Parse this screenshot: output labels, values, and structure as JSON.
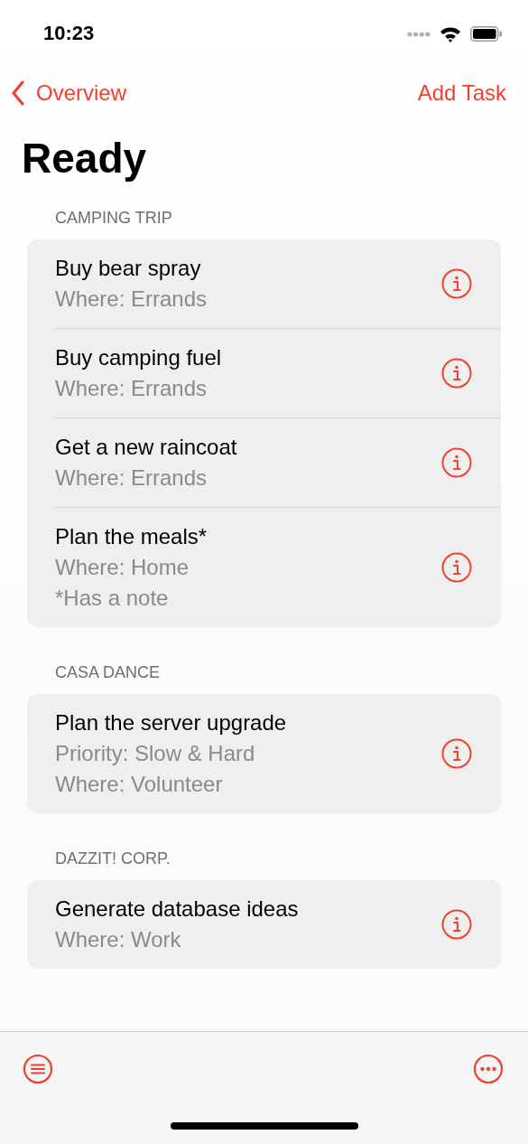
{
  "status_bar": {
    "time": "10:23"
  },
  "nav": {
    "back": "Overview",
    "action": "Add Task"
  },
  "title": "Ready",
  "sections": [
    {
      "header": "CAMPING TRIP",
      "tasks": [
        {
          "title": "Buy bear spray",
          "details": [
            "Where: Errands"
          ]
        },
        {
          "title": "Buy camping fuel",
          "details": [
            "Where: Errands"
          ]
        },
        {
          "title": "Get a new raincoat",
          "details": [
            "Where: Errands"
          ]
        },
        {
          "title": "Plan the meals*",
          "details": [
            "Where: Home",
            "*Has a note"
          ]
        }
      ]
    },
    {
      "header": "CASA DANCE",
      "tasks": [
        {
          "title": "Plan the server upgrade",
          "details": [
            "Priority: Slow & Hard",
            "Where: Volunteer"
          ]
        }
      ]
    },
    {
      "header": "DAZZIT! CORP.",
      "tasks": [
        {
          "title": "Generate database ideas",
          "details": [
            "Where: Work"
          ]
        }
      ]
    }
  ]
}
